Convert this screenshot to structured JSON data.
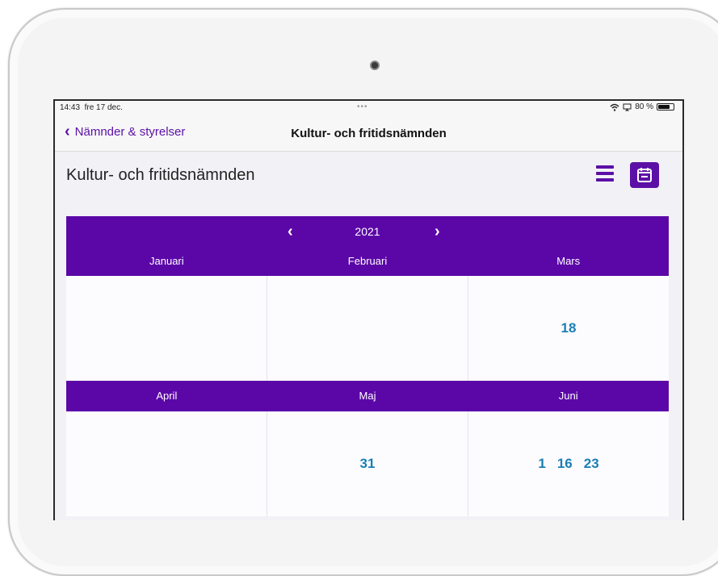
{
  "status": {
    "time": "14:43",
    "date": "fre 17 dec.",
    "dots": "•••",
    "battery_text": "80 %",
    "battery_level": 0.8
  },
  "nav": {
    "back_label": "Nämnder & styrelser",
    "title": "Kultur- och fritidsnämnden"
  },
  "page": {
    "title": "Kultur- och fritidsnämnden"
  },
  "calendar": {
    "year": "2021",
    "rows": [
      {
        "months": [
          {
            "name": "Januari",
            "days": []
          },
          {
            "name": "Februari",
            "days": []
          },
          {
            "name": "Mars",
            "days": [
              "18"
            ]
          }
        ]
      },
      {
        "months": [
          {
            "name": "April",
            "days": []
          },
          {
            "name": "Maj",
            "days": [
              "31"
            ]
          },
          {
            "name": "Juni",
            "days": [
              "1",
              "16",
              "23"
            ]
          }
        ]
      }
    ]
  },
  "colors": {
    "accent": "#5b07a8",
    "day_link": "#1a7fb6"
  },
  "icons": {
    "back": "chevron-left-icon",
    "list": "list-icon",
    "calendar": "calendar-icon",
    "wifi": "wifi-icon",
    "battery": "battery-icon"
  }
}
